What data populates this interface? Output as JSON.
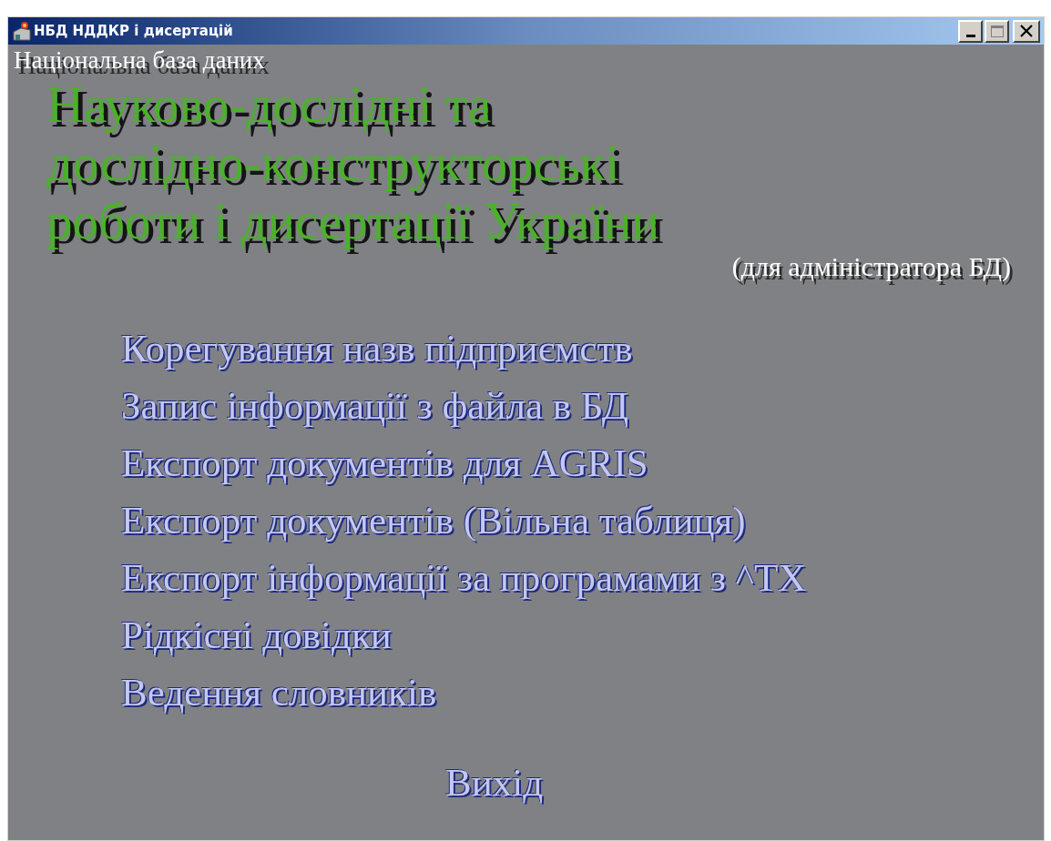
{
  "window": {
    "title": "НБД НДДКР і дисертацій"
  },
  "subtitle": "Національна база даних",
  "heading_lines": [
    "Науково-дослідні та",
    "дослідно-конструкторські",
    "роботи і дисертації України"
  ],
  "note": "(для адміністратора БД)",
  "menu": [
    {
      "label": "Корегування назв підприємств"
    },
    {
      "label": "Запис інформації з файла в БД"
    },
    {
      "label": "Експорт документів для AGRIS"
    },
    {
      "label": "Експорт документів (Вільна таблиця)"
    },
    {
      "label": "Експорт інформації за програмами з ^TX"
    },
    {
      "label": "Рідкісні довідки"
    },
    {
      "label": "Ведення словників"
    }
  ],
  "exit": "Вихід"
}
